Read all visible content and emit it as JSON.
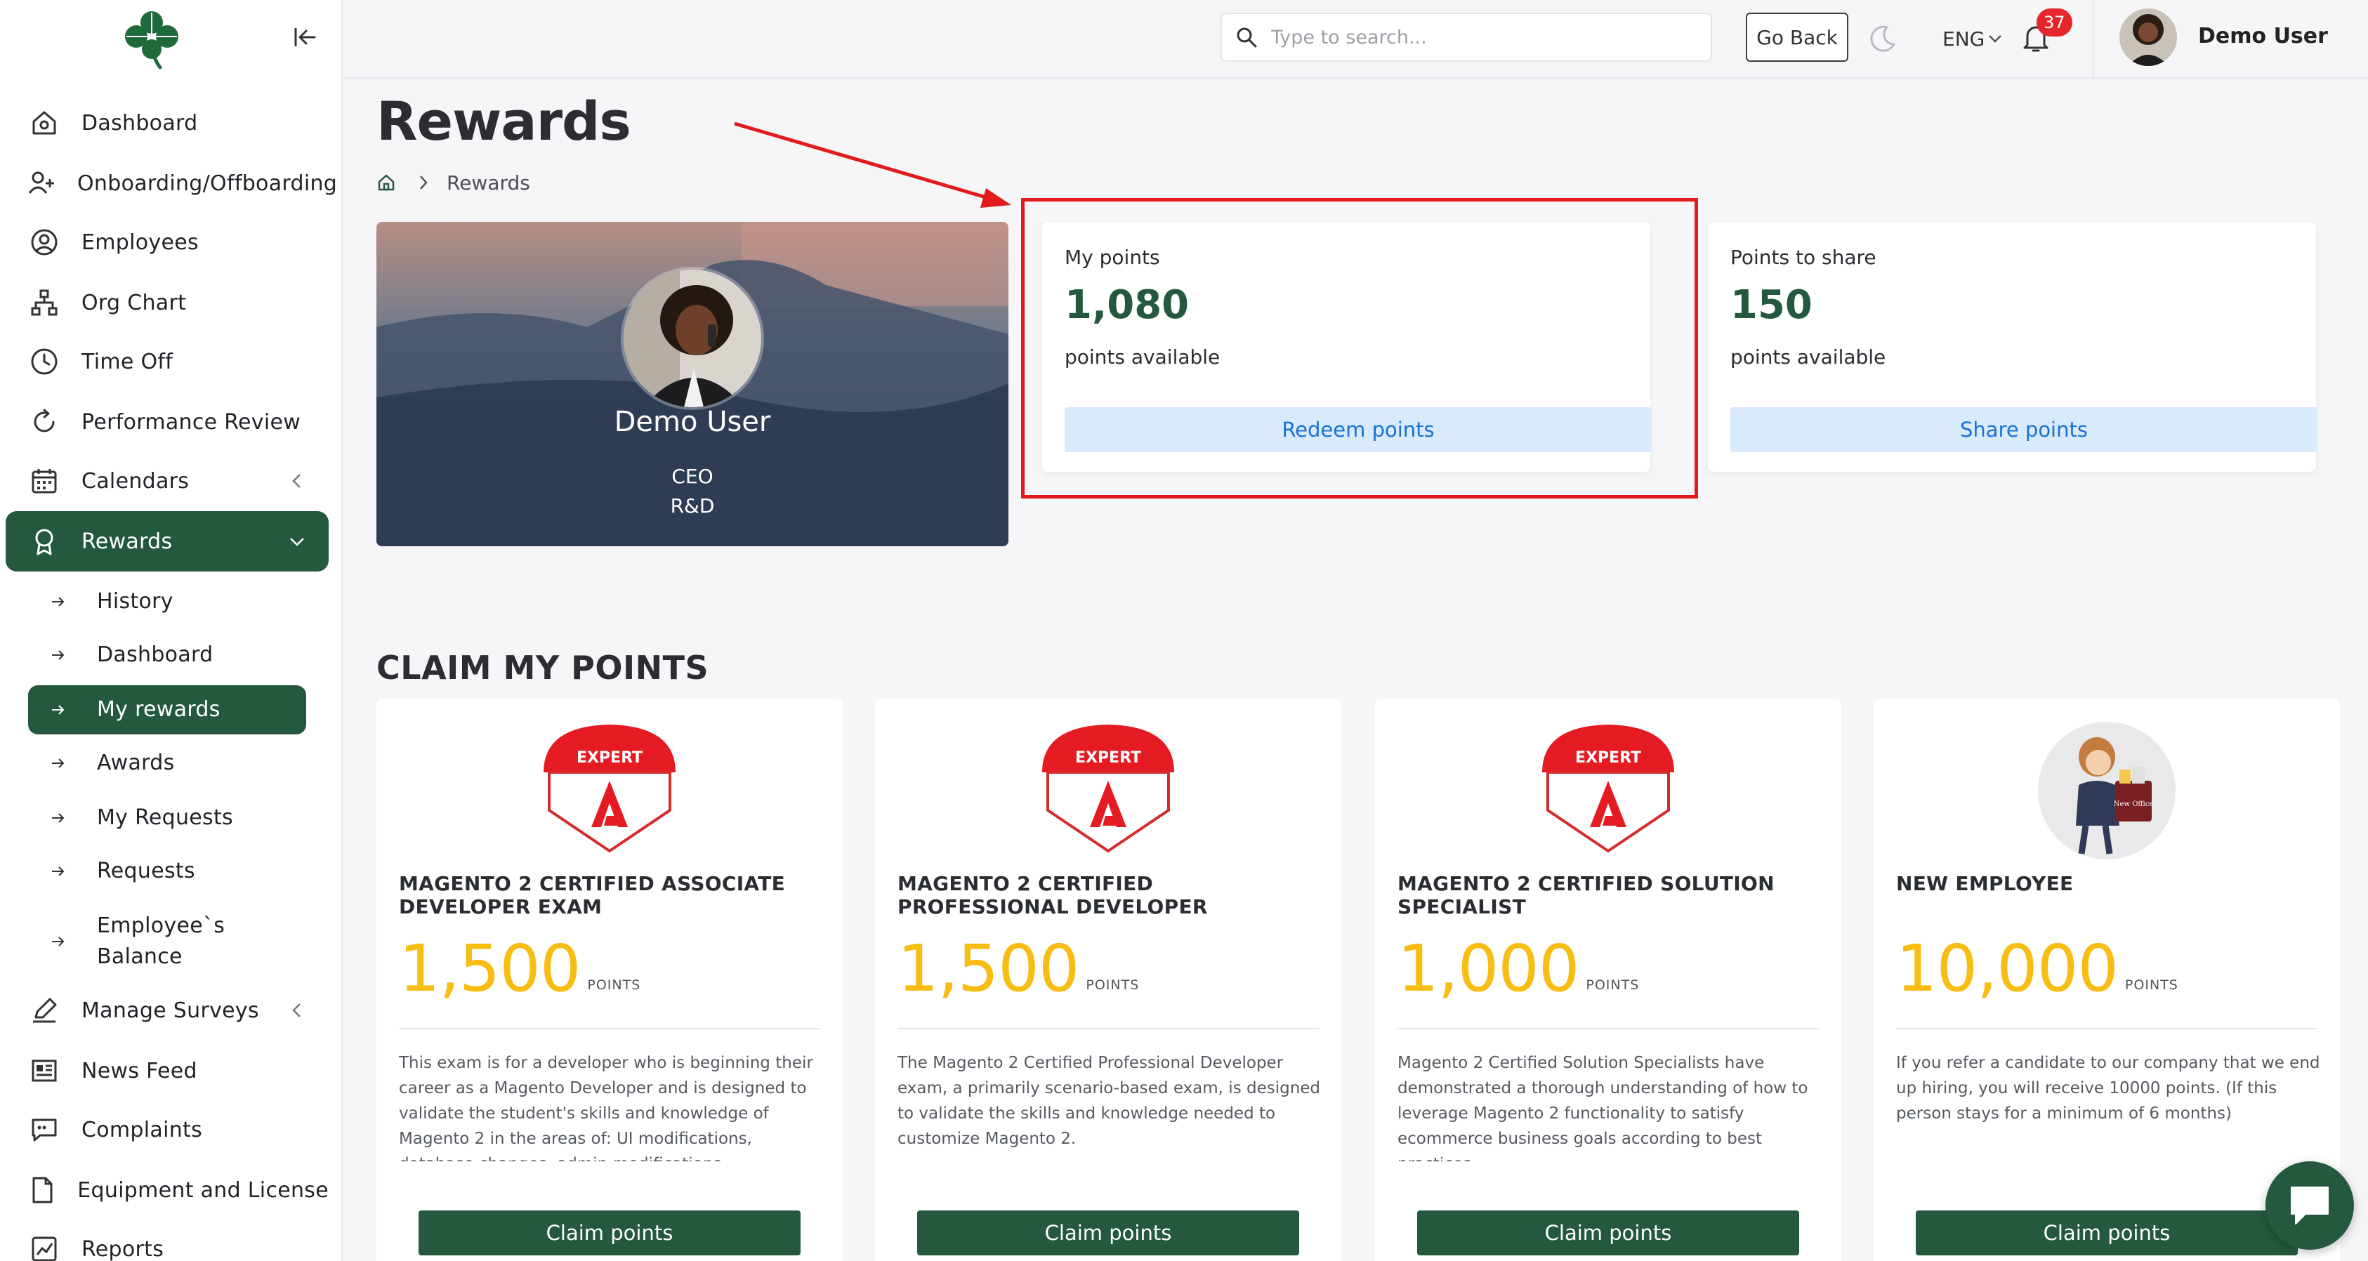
{
  "sidebar": {
    "items": [
      {
        "label": "Dashboard",
        "icon": "home-icon"
      },
      {
        "label": "Onboarding/Offboarding",
        "icon": "user-plus-icon"
      },
      {
        "label": "Employees",
        "icon": "user-circle-icon"
      },
      {
        "label": "Org Chart",
        "icon": "org-chart-icon"
      },
      {
        "label": "Time Off",
        "icon": "clock-icon"
      },
      {
        "label": "Performance Review",
        "icon": "refresh-icon"
      },
      {
        "label": "Calendars",
        "icon": "calendar-icon"
      },
      {
        "label": "Rewards",
        "icon": "award-icon"
      },
      {
        "label": "Manage Surveys",
        "icon": "edit-icon"
      },
      {
        "label": "News Feed",
        "icon": "newspaper-icon"
      },
      {
        "label": "Complaints",
        "icon": "message-icon"
      },
      {
        "label": "Equipment and License",
        "icon": "file-icon"
      },
      {
        "label": "Reports",
        "icon": "chart-icon"
      }
    ],
    "rewards_sub": [
      "History",
      "Dashboard",
      "My rewards",
      "Awards",
      "My Requests",
      "Requests",
      "Employee`s Balance"
    ]
  },
  "topbar": {
    "search_placeholder": "Type to search...",
    "go_back": "Go Back",
    "language": "ENG",
    "notifications": "37",
    "user_name": "Demo User"
  },
  "page": {
    "title": "Rewards",
    "breadcrumb": "Rewards"
  },
  "profile": {
    "name": "Demo User",
    "role": "CEO",
    "department": "R&D"
  },
  "my_points": {
    "label": "My points",
    "value": "1,080",
    "sub": "points available",
    "button": "Redeem points"
  },
  "share_points": {
    "label": "Points to share",
    "value": "150",
    "sub": "points available",
    "button": "Share points"
  },
  "claim": {
    "title": "CLAIM MY POINTS",
    "unit": "POINTS",
    "button": "Claim points",
    "badge_label": "EXPERT",
    "cards": [
      {
        "title": "MAGENTO 2 CERTIFIED ASSOCIATE DEVELOPER EXAM",
        "points": "1,500",
        "description": "This exam is for a developer who is beginning their career as a Magento Developer and is designed to validate the student's skills and knowledge of Magento 2 in the areas of: UI modifications, database changes, admin modifications"
      },
      {
        "title": "MAGENTO 2 CERTIFIED PROFESSIONAL DEVELOPER",
        "points": "1,500",
        "description": "The Magento 2 Certified Professional Developer exam, a primarily scenario-based exam, is designed to validate the skills and knowledge needed to customize Magento 2."
      },
      {
        "title": "MAGENTO 2 CERTIFIED SOLUTION SPECIALIST",
        "points": "1,000",
        "description": "Magento 2 Certified Solution Specialists have demonstrated a thorough understanding of how to leverage Magento 2 functionality to satisfy ecommerce business goals according to best practices"
      },
      {
        "title": "NEW EMPLOYEE",
        "points": "10,000",
        "description": "If you refer a candidate to our company that we end up hiring, you will receive 10000 points. (If this person stays for a minimum of 6 months)"
      }
    ]
  },
  "colors": {
    "brand_green": "#24593f",
    "points_yellow": "#f7bd13",
    "annotation_red": "#e11b1b",
    "button_blue_bg": "#d9eafc",
    "button_blue_text": "#1a73d6"
  }
}
